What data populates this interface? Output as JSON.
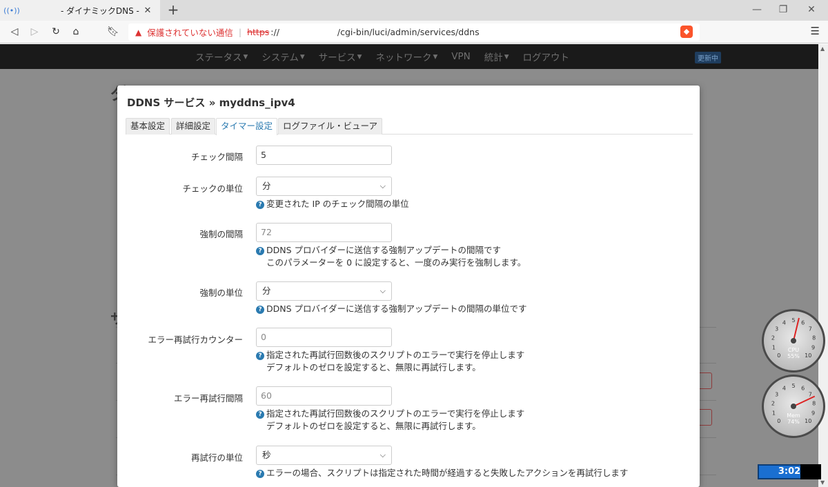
{
  "browser": {
    "tab_title": "- ダイナミックDNS - LuC",
    "new_tab": "+",
    "security_warning": "保護されていない通信",
    "url_protocol": "https",
    "url_separator": "://",
    "url_path": "/cgi-bin/luci/admin/services/ddns"
  },
  "nav": {
    "items": [
      "ステータス",
      "システム",
      "サービス",
      "ネットワーク",
      "VPN",
      "統計",
      "ログアウト"
    ],
    "status_badge": "更新中"
  },
  "modal": {
    "title": "DDNS サービス » myddns_ipv4",
    "tabs": [
      "基本設定",
      "詳細設定",
      "タイマー設定",
      "ログファイル・ビューア"
    ],
    "active_tab": "タイマー設定",
    "fields": [
      {
        "label": "チェック間隔",
        "type": "input",
        "value": "5",
        "placeholder": false,
        "help": []
      },
      {
        "label": "チェックの単位",
        "type": "select",
        "value": "分",
        "help": [
          "変更された IP のチェック間隔の単位"
        ]
      },
      {
        "label": "強制の間隔",
        "type": "input",
        "value": "72",
        "placeholder": true,
        "help": [
          "DDNS プロバイダーに送信する強制アップデートの間隔です",
          "このパラメーターを 0 に設定すると、一度のみ実行を強制します。"
        ]
      },
      {
        "label": "強制の単位",
        "type": "select",
        "value": "分",
        "help": [
          "DDNS プロバイダーに送信する強制アップデートの間隔の単位です"
        ]
      },
      {
        "label": "エラー再試行カウンター",
        "type": "input",
        "value": "0",
        "placeholder": true,
        "help": [
          "指定された再試行回数後のスクリプトのエラーで実行を停止します",
          "デフォルトのゼロを設定すると、無限に再試行します。"
        ]
      },
      {
        "label": "エラー再試行間隔",
        "type": "input",
        "value": "60",
        "placeholder": true,
        "help": [
          "指定された再試行回数後のスクリプトのエラーで実行を停止します",
          "デフォルトのゼロを設定すると、無限に再試行します。"
        ]
      },
      {
        "label": "再試行の単位",
        "type": "select",
        "value": "秒",
        "help": [
          "エラーの場合、スクリプトは指定された時間が経過すると失敗したアクションを再試行します"
        ]
      }
    ]
  },
  "gauges": [
    {
      "name": "CPU",
      "value_text": "55%",
      "level": 0.55
    },
    {
      "name": "Mem",
      "value_text": "74%",
      "level": 0.74
    }
  ],
  "clock": "3:02",
  "colors": {
    "accent": "#2a7ab0",
    "warning": "#dd3333",
    "nav_bg": "#1a1a1a",
    "clock_bg": "#1a6fd1"
  }
}
